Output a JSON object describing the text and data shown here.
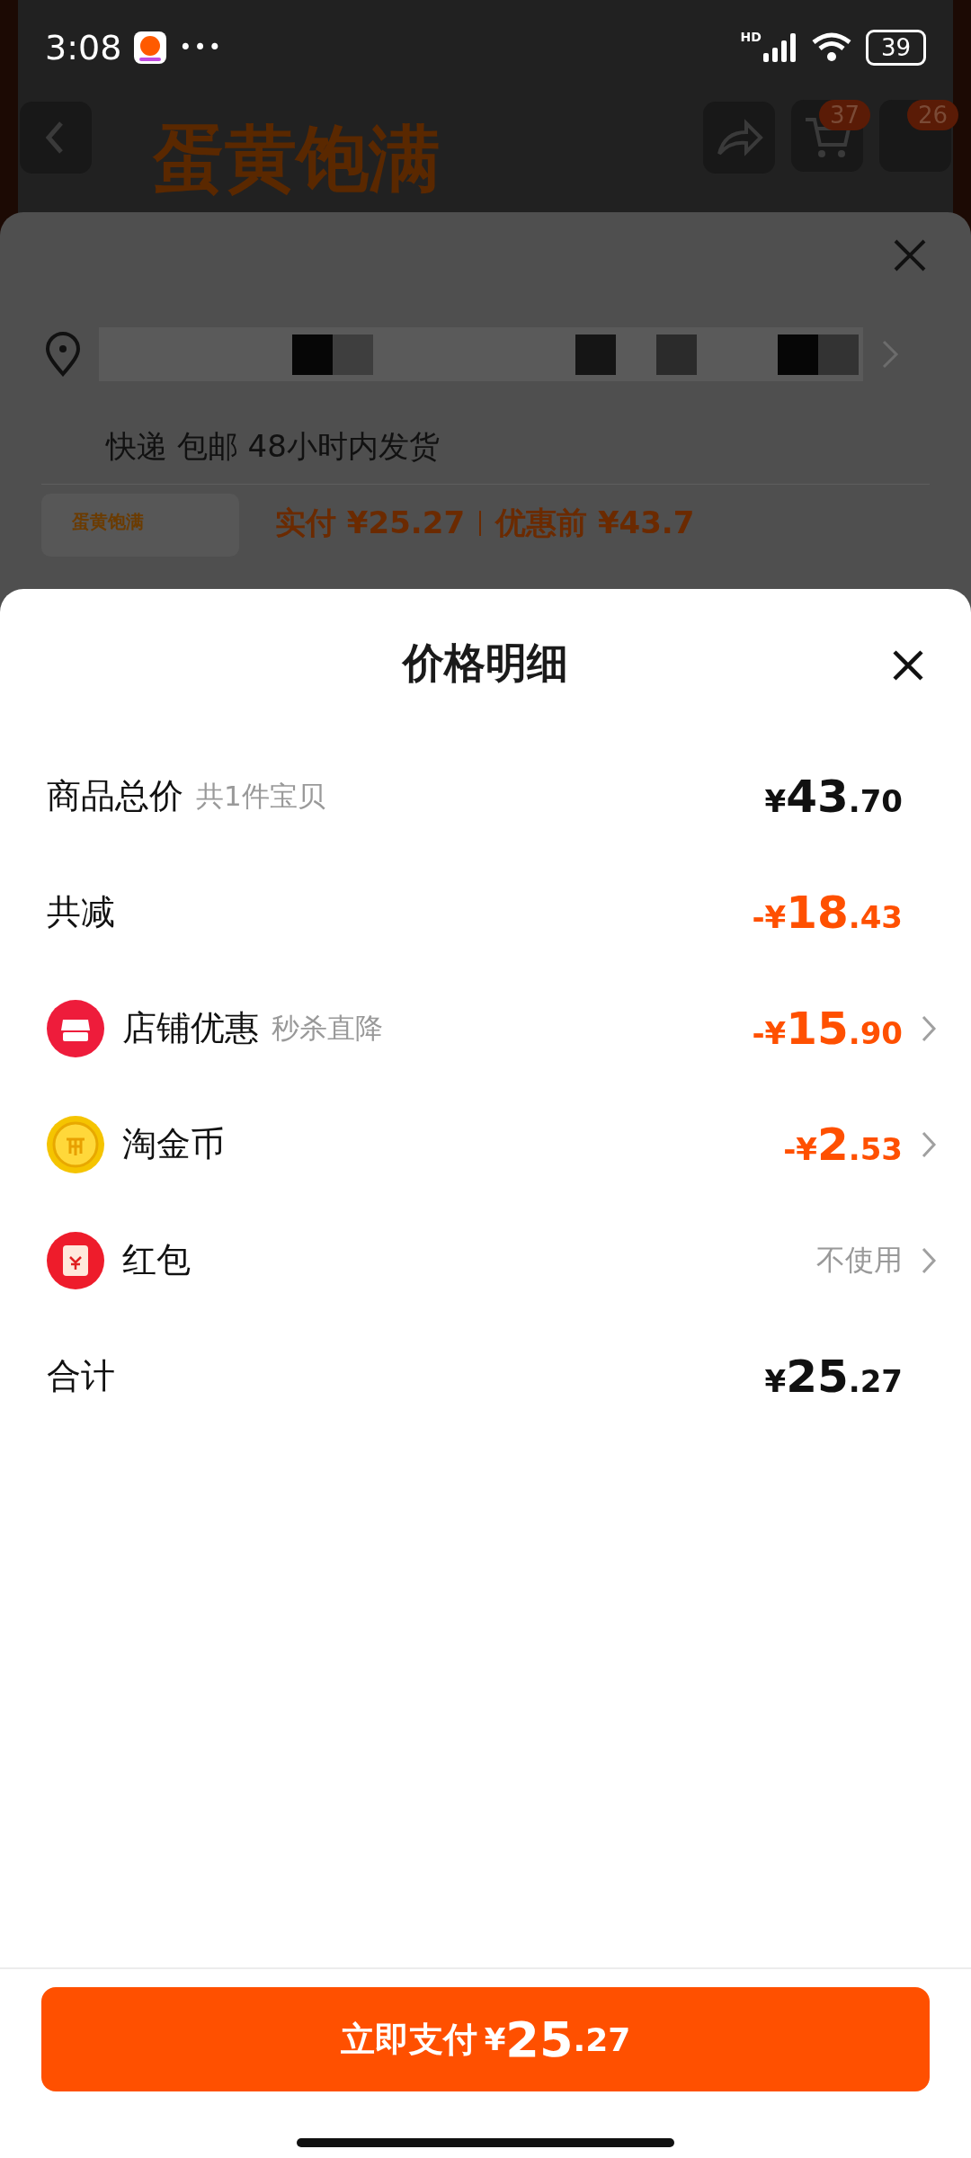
{
  "status_bar": {
    "time": "3:08",
    "more": "•••",
    "network": "HD",
    "battery": "39"
  },
  "background_page": {
    "title": "蛋黄饱满",
    "cart_badge": "37",
    "menu_badge": "26"
  },
  "order_sheet": {
    "delivery": "快递 包邮 48小时内发货",
    "thumbnail_text": "蛋黄饱满",
    "paid_label": "实付",
    "paid_amount": "¥25.27",
    "before_label": "优惠前",
    "before_amount": "¥43.7"
  },
  "price_detail": {
    "title": "价格明细",
    "rows": [
      {
        "kind": "plain",
        "label": "商品总价",
        "note": "共1件宝贝",
        "amount": "¥43.70",
        "discount": false,
        "chevron": false
      },
      {
        "kind": "plain",
        "label": "共减",
        "amount": "-¥18.43",
        "discount": true,
        "chevron": false
      },
      {
        "kind": "shop",
        "label": "店铺优惠",
        "note": "秒杀直降",
        "amount": "-¥15.90",
        "discount": true,
        "chevron": true
      },
      {
        "kind": "coin",
        "label": "淘金币",
        "amount": "-¥2.53",
        "discount": true,
        "chevron": true
      },
      {
        "kind": "packet",
        "label": "红包",
        "amount": "不使用",
        "discount": false,
        "chevron": true
      },
      {
        "kind": "plain",
        "label": "合计",
        "amount": "¥25.27",
        "discount": false,
        "chevron": false
      }
    ]
  },
  "pay_button": {
    "label": "立即支付",
    "amount": "¥25.27"
  }
}
